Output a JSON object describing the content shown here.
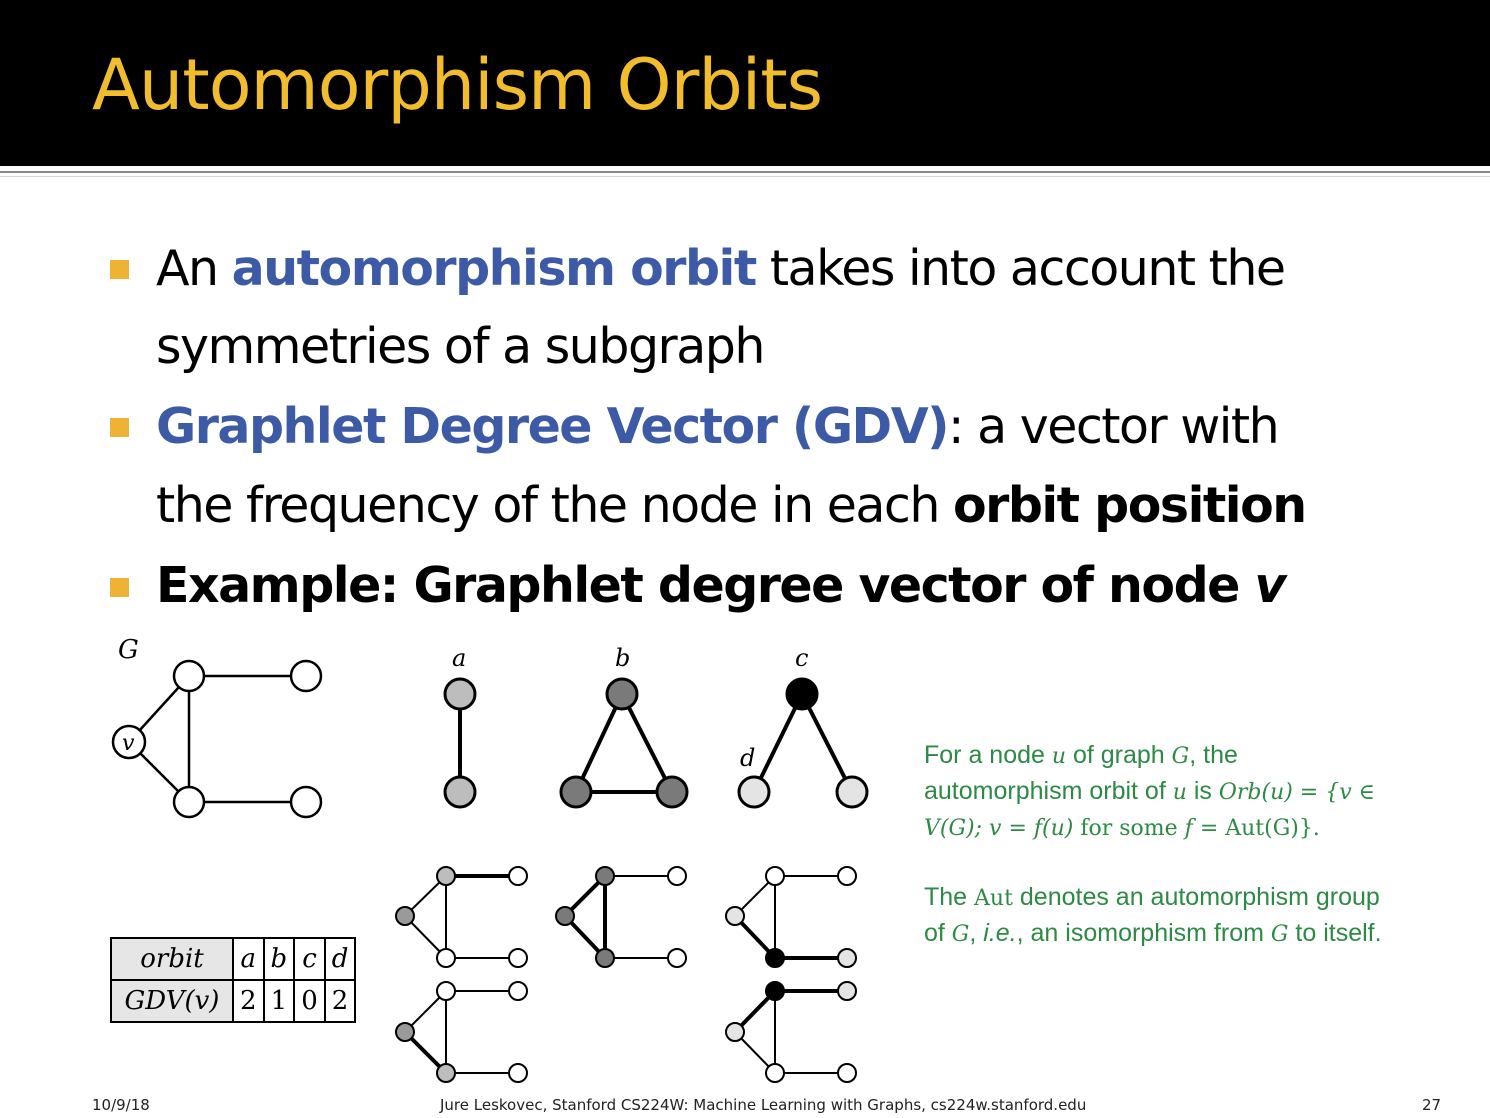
{
  "slide": {
    "title": "Automorphism Orbits",
    "bullets": [
      {
        "line1_parts": [
          "An ",
          "automorphism orbit",
          " takes into account the"
        ],
        "line2": "symmetries of a subgraph"
      },
      {
        "line1_parts": [
          "Graphlet Degree Vector (GDV)",
          ": a vector with"
        ],
        "line2_parts": [
          "the frequency of the node in each ",
          "orbit position"
        ]
      },
      {
        "line1_parts": [
          "Example: Graphlet degree vector of node ",
          "v"
        ]
      }
    ],
    "accent_colors": {
      "title": "#f2bd2c",
      "bullet": "#eeb335",
      "highlight": "#3c5aa6",
      "note": "#2c8a45"
    }
  },
  "diagram": {
    "graph_label": "G",
    "node_label": "v",
    "orbit_labels": [
      "a",
      "b",
      "c",
      "d"
    ]
  },
  "note": {
    "line1": [
      "For a node ",
      "u",
      " of graph ",
      "G",
      ", the"
    ],
    "line2": [
      "automorphism orbit of ",
      "u",
      " is ",
      "Orb(u) = {v ∈"
    ],
    "line3": [
      "V(G); v = f(u)",
      " for some ",
      "f",
      " = Aut(G)}."
    ],
    "line4": [
      "The ",
      "Aut",
      " denotes an automorphism group"
    ],
    "line5": [
      "of ",
      "G",
      ", ",
      "i.e.",
      ", an isomorphism from ",
      "G",
      " to itself."
    ]
  },
  "table": {
    "header": [
      "orbit",
      "a",
      "b",
      "c",
      "d"
    ],
    "row_label": "GDV(v)",
    "values": [
      "2",
      "1",
      "0",
      "2"
    ]
  },
  "footer": {
    "date": "10/9/18",
    "credit": "Jure Leskovec, Stanford CS224W: Machine Learning with Graphs, cs224w.stanford.edu",
    "page": "27"
  }
}
